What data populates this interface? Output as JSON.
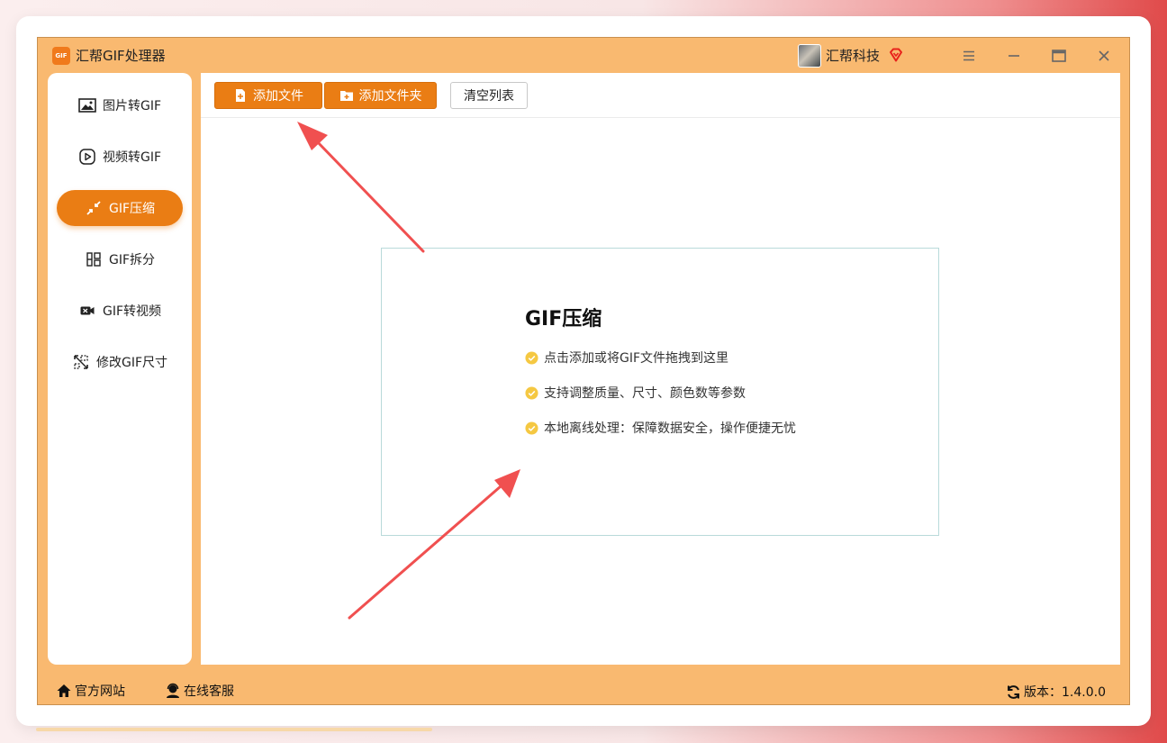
{
  "app": {
    "logo_text": "GIF",
    "title": "汇帮GIF处理器",
    "user_name": "汇帮科技"
  },
  "colors": {
    "frame": "#f9b970",
    "accent": "#ea7d14",
    "arrow": "#f05050",
    "check": "#f5c842"
  },
  "sidebar": {
    "items": [
      {
        "label": "图片转GIF",
        "icon": "image-icon",
        "active": false
      },
      {
        "label": "视频转GIF",
        "icon": "play-circle-icon",
        "active": false
      },
      {
        "label": "GIF压缩",
        "icon": "compress-icon",
        "active": true
      },
      {
        "label": "GIF拆分",
        "icon": "split-grid-icon",
        "active": false
      },
      {
        "label": "GIF转视频",
        "icon": "video-camera-icon",
        "active": false
      },
      {
        "label": "修改GIF尺寸",
        "icon": "resize-icon",
        "active": false
      }
    ]
  },
  "toolbar": {
    "add_file": "添加文件",
    "add_folder": "添加文件夹",
    "clear_list": "清空列表"
  },
  "dropzone": {
    "title": "GIF压缩",
    "tips": [
      "点击添加或将GIF文件拖拽到这里",
      "支持调整质量、尺寸、颜色数等参数",
      "本地离线处理：保障数据安全，操作便捷无忧"
    ]
  },
  "footer": {
    "website": "官方网站",
    "service": "在线客服",
    "version": "版本：1.4.0.0"
  }
}
